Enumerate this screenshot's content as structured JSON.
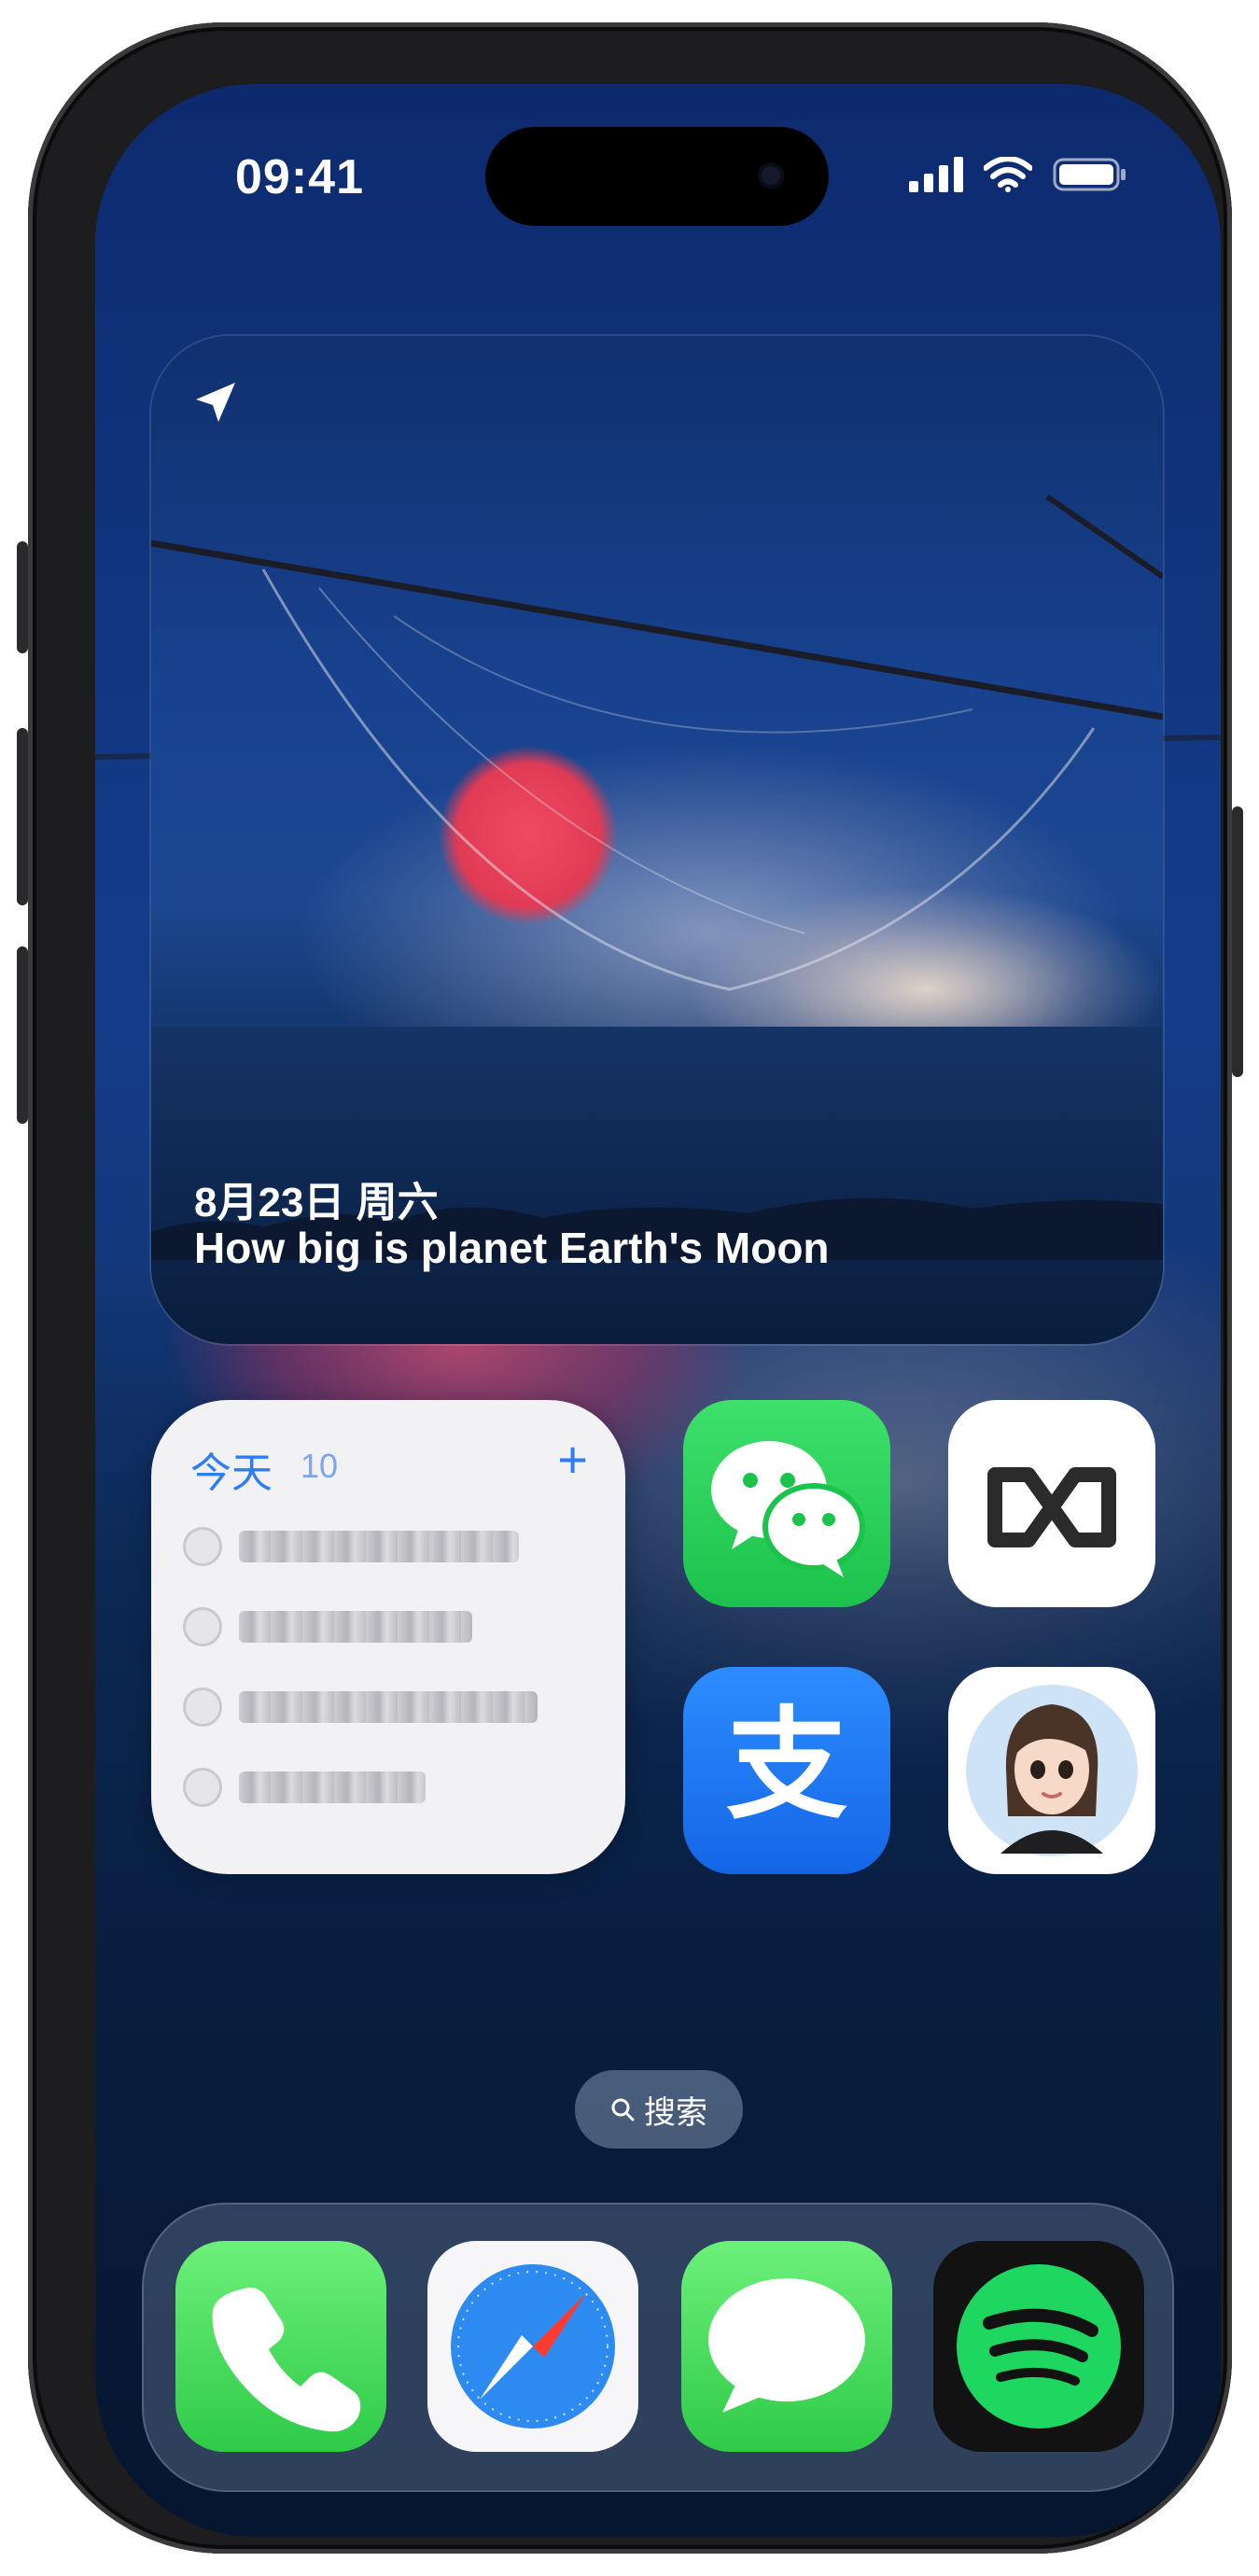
{
  "status_bar": {
    "time": "09:41"
  },
  "photo_widget": {
    "date": "8月23日 周六",
    "title": "How big is planet Earth's Moon",
    "icon": "location-arrow-icon"
  },
  "reminders_widget": {
    "title": "今天",
    "count": "10",
    "add_label": "+",
    "items_note": "blurred",
    "rows": 4
  },
  "apps": [
    {
      "name": "WeChat",
      "icon": "wechat-icon"
    },
    {
      "name": "Gamma",
      "icon": "gamma-logo-icon"
    },
    {
      "name": "Alipay",
      "icon": "alipay-icon",
      "glyph": "支"
    },
    {
      "name": "Avatar App",
      "icon": "avatar-icon"
    }
  ],
  "search": {
    "label": "搜索",
    "icon": "magnifier-icon"
  },
  "dock": [
    {
      "name": "Phone",
      "icon": "phone-icon"
    },
    {
      "name": "Safari",
      "icon": "compass-icon"
    },
    {
      "name": "Messages",
      "icon": "speech-bubble-icon"
    },
    {
      "name": "Spotify",
      "icon": "spotify-icon"
    }
  ],
  "colors": {
    "accent_blue": "#2f7cf6",
    "wechat_green": "#1bc24b",
    "alipay_blue": "#1466e6",
    "spotify_green": "#1ed760"
  }
}
